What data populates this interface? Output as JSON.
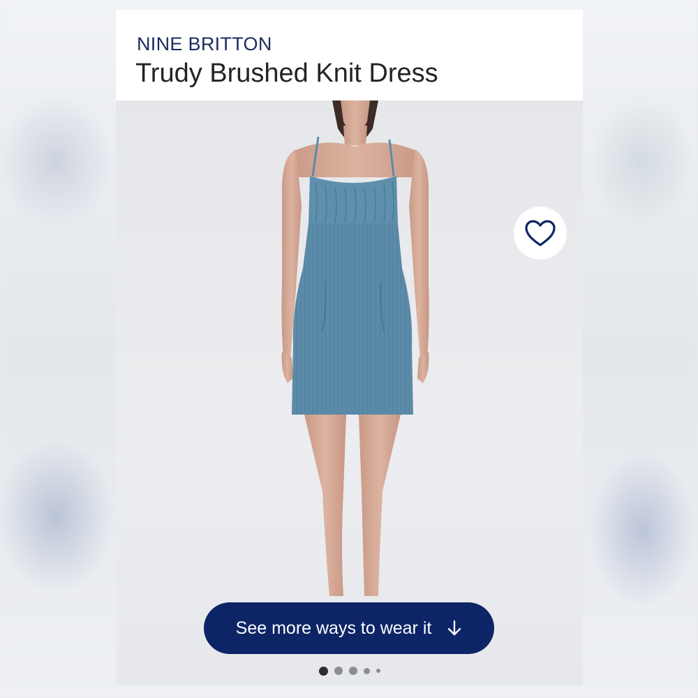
{
  "product": {
    "brand": "NINE BRITTON",
    "title": "Trudy Brushed Knit Dress"
  },
  "favorite": {
    "icon": "heart-icon"
  },
  "cta": {
    "label": "See more ways to wear it",
    "icon": "arrow-down-icon"
  },
  "carousel": {
    "total": 5,
    "active_index": 0
  },
  "colors": {
    "brand_text": "#1b2a5e",
    "cta_background": "#0d2566",
    "dress": "#5b8ba8"
  }
}
